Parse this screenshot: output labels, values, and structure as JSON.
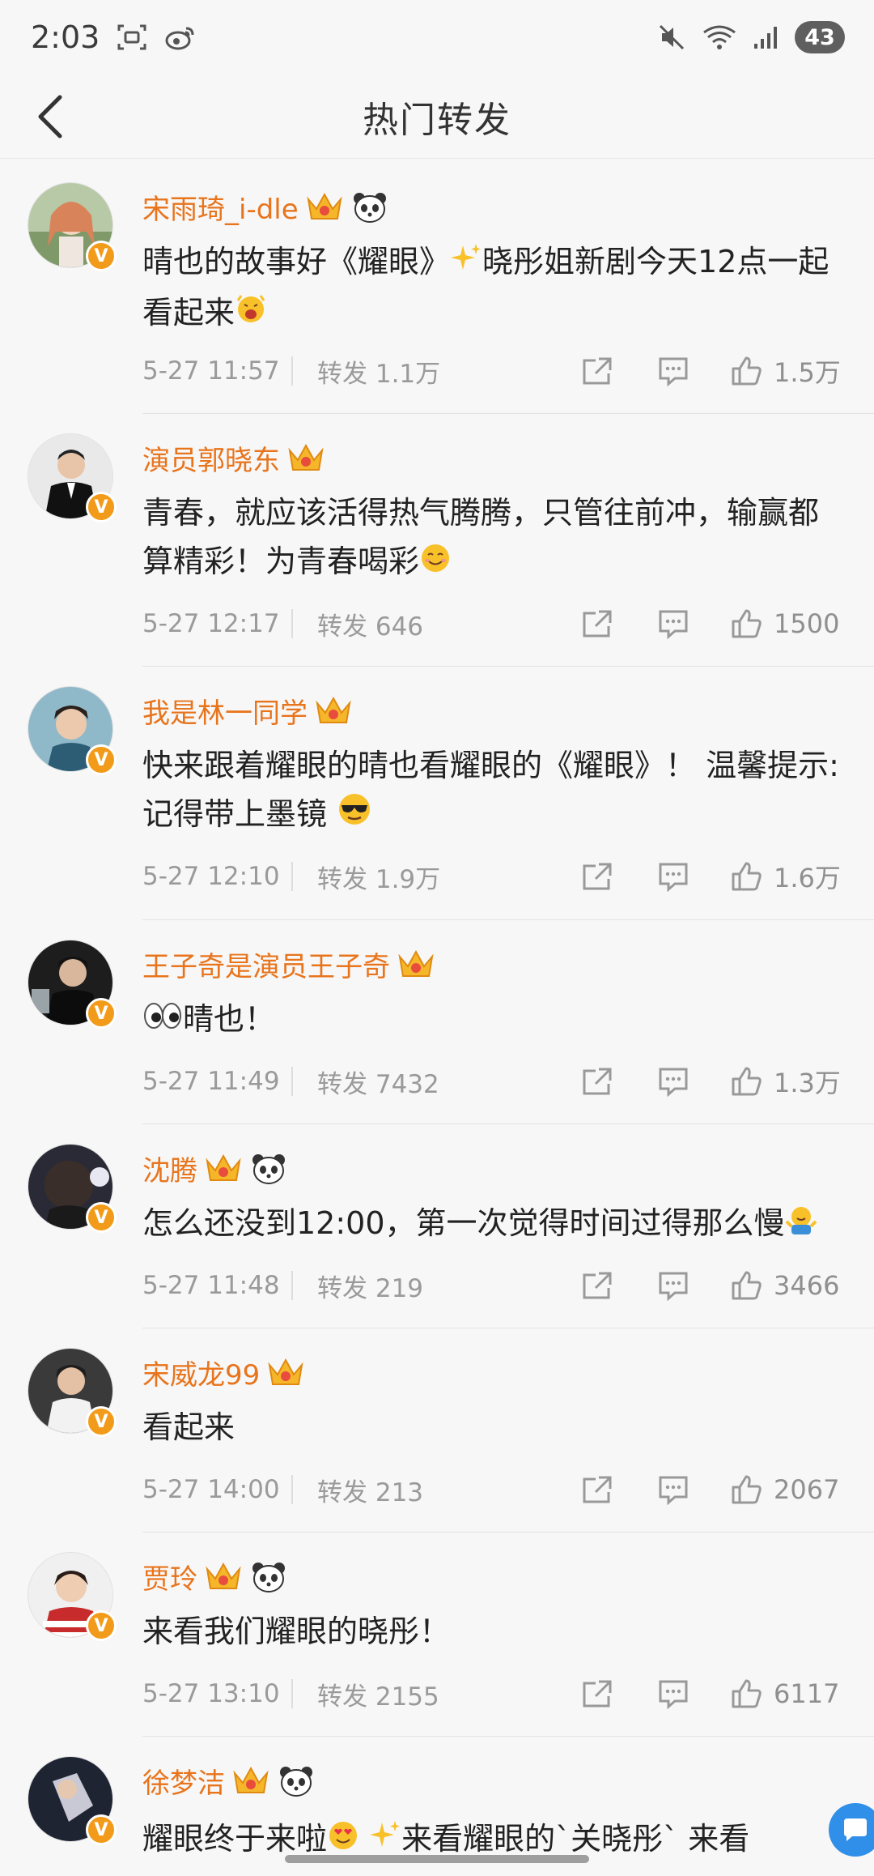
{
  "status_bar": {
    "time": "2:03",
    "battery": "43"
  },
  "header": {
    "title": "热门转发"
  },
  "posts": [
    {
      "username": "宋雨琦_i-dle",
      "text_before": "晴也的故事好《耀眼》",
      "text_middle": "晓彤姐新剧今天12点一起看起来",
      "text_after": "",
      "date": "5-27 11:57",
      "forward": "转发 1.1万",
      "likes": "1.5万"
    },
    {
      "username": "演员郭晓东",
      "text_before": "青春，就应该活得热气腾腾，只管往前冲，输赢都算精彩！为青春喝彩",
      "text_middle": "",
      "text_after": "",
      "date": "5-27 12:17",
      "forward": "转发 646",
      "likes": "1500"
    },
    {
      "username": "我是林一同学",
      "text_before": "快来跟着耀眼的晴也看耀眼的《耀眼》！ 温馨提示:记得带上墨镜",
      "text_middle": "",
      "text_after": "",
      "date": "5-27 12:10",
      "forward": "转发 1.9万",
      "likes": "1.6万"
    },
    {
      "username": "王子奇是演员王子奇",
      "text_before": "",
      "text_middle": "晴也！",
      "text_after": "",
      "date": "5-27 11:49",
      "forward": "转发 7432",
      "likes": "1.3万"
    },
    {
      "username": "沈腾",
      "text_before": "怎么还没到12:00，第一次觉得时间过得那么慢",
      "text_middle": "",
      "text_after": "",
      "date": "5-27 11:48",
      "forward": "转发 219",
      "likes": "3466"
    },
    {
      "username": "宋威龙99",
      "text_before": "看起来",
      "text_middle": "",
      "text_after": "",
      "date": "5-27 14:00",
      "forward": "转发 213",
      "likes": "2067"
    },
    {
      "username": "贾玲",
      "text_before": "来看我们耀眼的晓彤！",
      "text_middle": "",
      "text_after": "",
      "date": "5-27 13:10",
      "forward": "转发 2155",
      "likes": "6117"
    },
    {
      "username": "徐梦洁",
      "text_before": "耀眼终于来啦",
      "text_middle": "来看耀眼的",
      "text_after": "`关晓彤`  来看"
    }
  ],
  "colors": {
    "username": "#e8741c",
    "verified_badge": "#f29b1a",
    "float_button": "#2f8fe9"
  }
}
